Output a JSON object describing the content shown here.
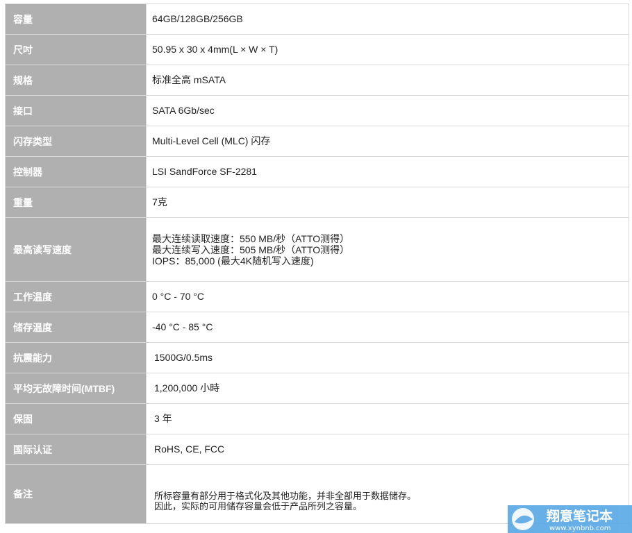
{
  "specs": [
    {
      "label": "容量",
      "values": [
        "64GB/128GB/256GB"
      ]
    },
    {
      "label": "尺吋",
      "values": [
        "50.95 x 30 x 4mm(L × W × T)"
      ]
    },
    {
      "label": "规格",
      "values": [
        "标准全高 mSATA"
      ]
    },
    {
      "label": "接口",
      "values": [
        "SATA 6Gb/sec"
      ]
    },
    {
      "label": "闪存类型",
      "values": [
        "Multi-Level Cell (MLC) 闪存"
      ]
    },
    {
      "label": "控制器",
      "values": [
        "LSI SandForce SF-2281"
      ]
    },
    {
      "label": "重量",
      "values": [
        "7克"
      ]
    },
    {
      "label": "最高读写速度",
      "values": [
        "最大连续读取速度：550 MB/秒（ATTO测得）",
        "最大连续写入速度：505 MB/秒（ATTO测得）",
        "IOPS：85,000 (最大4K随机写入速度)"
      ]
    },
    {
      "label": "工作温度",
      "values": [
        "0 °C - 70 °C"
      ]
    },
    {
      "label": "储存温度",
      "values": [
        "-40 °C - 85 °C"
      ]
    },
    {
      "label": "抗震能力",
      "values": [
        "1500G/0.5ms"
      ]
    },
    {
      "label": "平均无故障时间(MTBF)",
      "values": [
        "1,200,000 小時"
      ]
    },
    {
      "label": "保固",
      "values": [
        "3 年"
      ]
    },
    {
      "label": "国际认证",
      "values": [
        "RoHS, CE, FCC"
      ]
    },
    {
      "label": "备注",
      "values": [
        "所标容量有部分用于格式化及其他功能，并非全部用于数据储存。",
        "因此，实际的可用储存容量会低于产品所列之容量。"
      ]
    }
  ],
  "watermark": {
    "text": "翔意笔记本",
    "url": "www.xynbnb.com"
  },
  "colors": {
    "label_bg": "#b0b0b0",
    "label_text": "#ffffff",
    "border": "#d9d9d9",
    "watermark_bg": "#5aa9e6"
  }
}
